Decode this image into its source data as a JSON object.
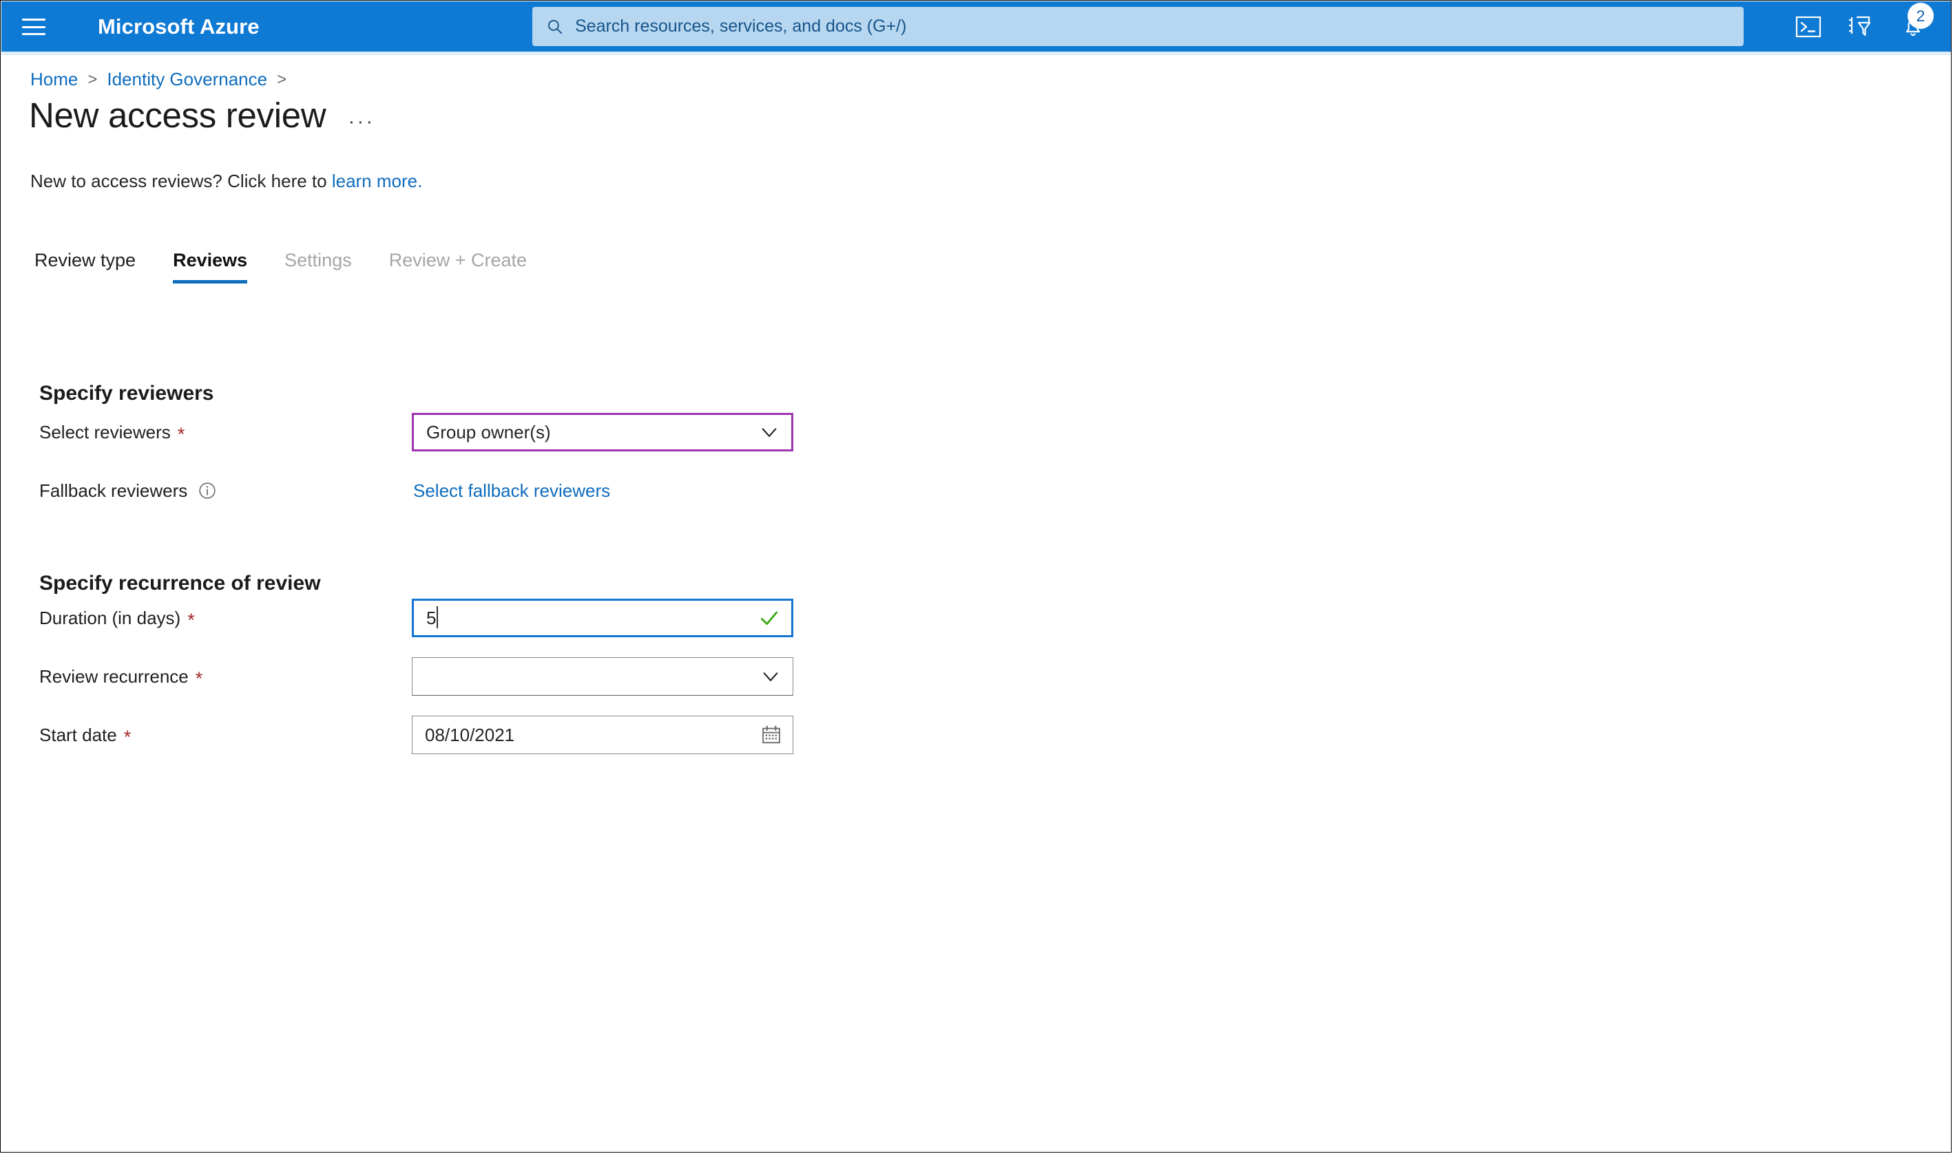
{
  "topbar": {
    "menu_icon": "hamburger-icon",
    "brand": "Microsoft Azure",
    "search_placeholder": "Search resources, services, and docs (G+/)",
    "search_icon": "search-icon",
    "icons": [
      {
        "name": "cloud-shell-icon",
        "label": "Cloud Shell"
      },
      {
        "name": "directories-subscriptions-icon",
        "label": "Directories + subscriptions"
      },
      {
        "name": "notifications-bell-icon",
        "label": "Notifications"
      }
    ],
    "notification_count": "2",
    "accent_blue": "#0f7ad4"
  },
  "breadcrumb": {
    "items": [
      {
        "label": "Home"
      },
      {
        "label": "Identity Governance"
      }
    ],
    "separator": ">",
    "trailing_separator": ">"
  },
  "header": {
    "title": "New access review",
    "more_actions": "···"
  },
  "intro": {
    "text": "New to access reviews? Click here to ",
    "link": "learn more."
  },
  "tabs": [
    {
      "label": "Review type",
      "state": "enabled"
    },
    {
      "label": "Reviews",
      "state": "selected"
    },
    {
      "label": "Settings",
      "state": "disabled"
    },
    {
      "label": "Review + Create",
      "state": "disabled"
    }
  ],
  "sections": {
    "reviewers": {
      "heading": "Specify reviewers",
      "select_reviewers": {
        "label": "Select reviewers",
        "required": "*",
        "value": "Group owner(s)",
        "border_color": "#9b36b0",
        "icon": "chevron-down-icon"
      },
      "fallback_reviewers": {
        "label": "Fallback reviewers",
        "info_icon": "info-circle-icon",
        "link": "Select fallback reviewers"
      }
    },
    "recurrence": {
      "heading": "Specify recurrence of review",
      "duration": {
        "label": "Duration (in days)",
        "required": "*",
        "value": "5",
        "border_color": "#1374d2",
        "validation_icon": "green-check-icon"
      },
      "review_recurrence": {
        "label": "Review recurrence",
        "required": "*",
        "value": "",
        "icon": "chevron-down-icon"
      },
      "start_date": {
        "label": "Start date",
        "required": "*",
        "value": "08/10/2021",
        "icon": "calendar-icon"
      }
    }
  }
}
